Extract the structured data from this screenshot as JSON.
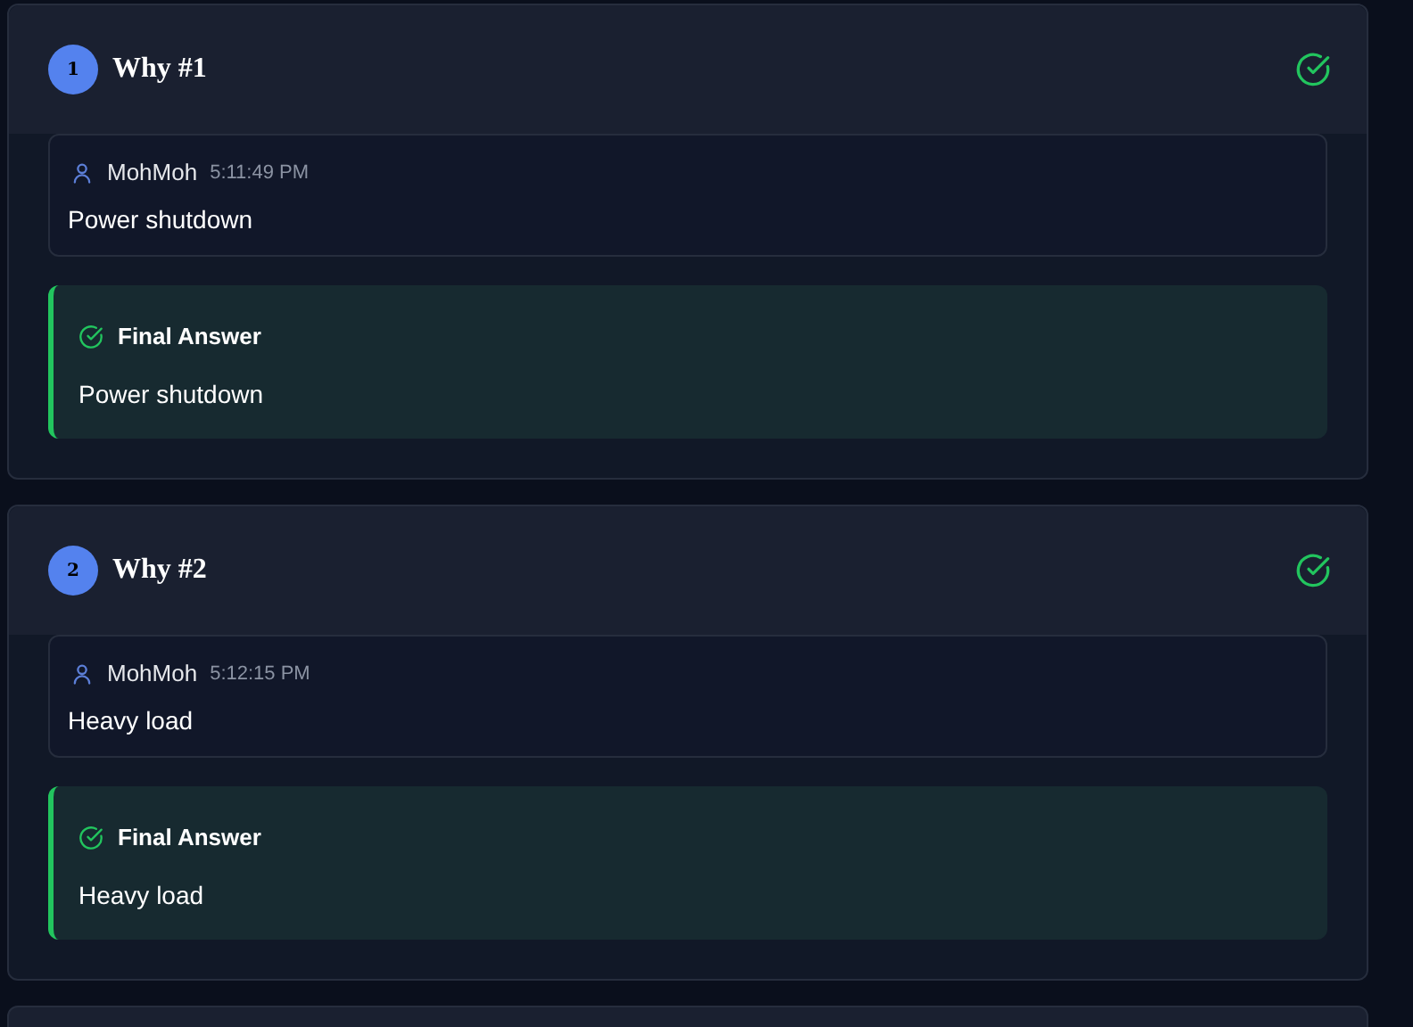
{
  "whys": [
    {
      "number": "1",
      "title": "Why #1",
      "completed": true,
      "message": {
        "author": "MohMoh",
        "time": "5:11:49 PM",
        "text": "Power shutdown"
      },
      "final_answer": {
        "label": "Final Answer",
        "text": "Power shutdown"
      }
    },
    {
      "number": "2",
      "title": "Why #2",
      "completed": true,
      "message": {
        "author": "MohMoh",
        "time": "5:12:15 PM",
        "text": "Heavy load"
      },
      "final_answer": {
        "label": "Final Answer",
        "text": "Heavy load"
      }
    }
  ]
}
